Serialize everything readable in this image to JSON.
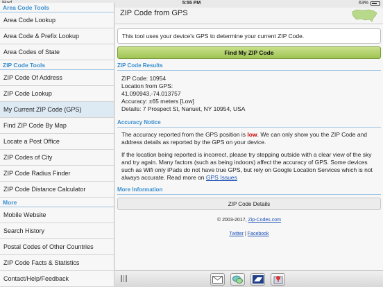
{
  "status": {
    "carrier": "iPad",
    "time": "5:55 PM",
    "battery": "63%"
  },
  "sidebar": {
    "sections": [
      {
        "title": "Area Code Tools",
        "items": [
          "Area Code Lookup",
          "Area Code & Prefix Lookup",
          "Area Codes of State"
        ]
      },
      {
        "title": "ZIP Code Tools",
        "items": [
          "ZIP Code Of Address",
          "ZIP Code Lookup",
          "My Current ZIP Code (GPS)",
          "Find ZIP Code By Map",
          "Locate a Post Office",
          "ZIP Codes of City",
          "ZIP Code Radius Finder",
          "ZIP Code Distance Calculator"
        ]
      },
      {
        "title": "More",
        "items": [
          "Mobile Website",
          "Search History",
          "Postal Codes of Other Countries",
          "ZIP Code Facts & Statistics",
          "Contact/Help/Feedback"
        ]
      }
    ]
  },
  "main": {
    "title": "ZIP Code from GPS",
    "intro": "This tool uses your device's GPS to determine your current ZIP Code.",
    "find_button": "Find My ZIP Code",
    "results_header": "ZIP Code Results",
    "results": {
      "zip": "ZIP Code: 10954",
      "location_label": "Location from GPS:",
      "coords": "41.090943,-74.013757",
      "accuracy": "Accuracy: ±65 meters [Low]",
      "details": "Details: 7 Prospect St, Nanuet, NY 10954, USA"
    },
    "notice_header": "Accuracy Notice",
    "notice": {
      "p1_before": "The accuracy reported from the GPS position is ",
      "p1_low": "low",
      "p1_after": ". We can only show you the ZIP Code and address details as reported by the GPS on your device.",
      "p2": "If the location being reported is incorrect, please try stepping outside with a clear view of the sky and try again. Many factors (such as being indoors) affect the accuracy of GPS. Some devices such as Wifi only iPads do not have true GPS, but rely on Google Location Services which is not always accurate. Read more on ",
      "p2_link": "GPS Issues"
    },
    "more_header": "More Information",
    "details_button": "ZIP Code Details",
    "footer": {
      "copyright": "© 2003-2017, ",
      "site_link": "Zip-Codes.com",
      "twitter": "Twitter",
      "separator": " | ",
      "facebook": "Facebook"
    }
  },
  "toolbar": {
    "icons": [
      "mail-icon",
      "chat-icon",
      "usps-icon",
      "map-pin-icon"
    ]
  },
  "colors": {
    "accent": "#3a8fd0",
    "button_green": "#9fc454",
    "low": "#cc0000"
  }
}
